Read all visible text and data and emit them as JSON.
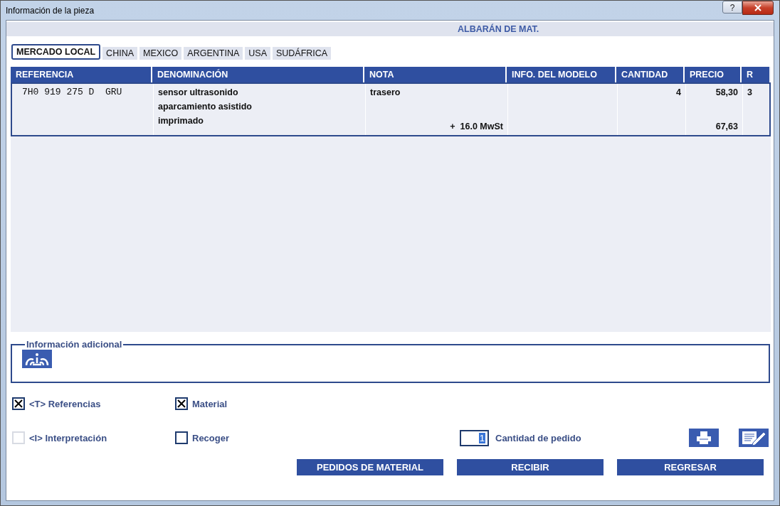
{
  "window": {
    "title": "Información de la pieza",
    "help": "?"
  },
  "header": {
    "title": "ALBARÁN DE MAT."
  },
  "tabs": [
    {
      "label": "MERCADO LOCAL",
      "selected": true
    },
    {
      "label": "CHINA",
      "selected": false
    },
    {
      "label": "MEXICO",
      "selected": false
    },
    {
      "label": "ARGENTINA",
      "selected": false
    },
    {
      "label": "USA",
      "selected": false
    },
    {
      "label": "SUDÁFRICA",
      "selected": false
    }
  ],
  "table": {
    "columns": [
      "REFERENCIA",
      "DENOMINACIÓN",
      "NOTA",
      "INFO. DEL MODELO",
      "CANTIDAD",
      "PRECIO",
      "R"
    ],
    "rows": [
      {
        "reference": "7H0 919 275 D  GRU",
        "description": [
          "sensor ultrasonido",
          "aparcamiento asistido",
          "imprimado"
        ],
        "note": "trasero",
        "tax": "+  16.0 MwSt",
        "quantity": "4",
        "price": "58,30",
        "price_with_tax": "67,63",
        "r": "3"
      }
    ]
  },
  "additional_info": {
    "legend": "Información adicional"
  },
  "options": [
    {
      "label": "<T> Referencias",
      "checked": true,
      "disabled": false
    },
    {
      "label": "Material",
      "checked": true,
      "disabled": false
    },
    {
      "label": "<I> Interpretación",
      "checked": false,
      "disabled": true
    },
    {
      "label": "Recoger",
      "checked": false,
      "disabled": false
    }
  ],
  "order_quantity": {
    "value": "1",
    "label": "Cantidad de pedido"
  },
  "buttons": [
    "PEDIDOS DE MATERIAL",
    "RECIBIR",
    "REGRESAR"
  ]
}
